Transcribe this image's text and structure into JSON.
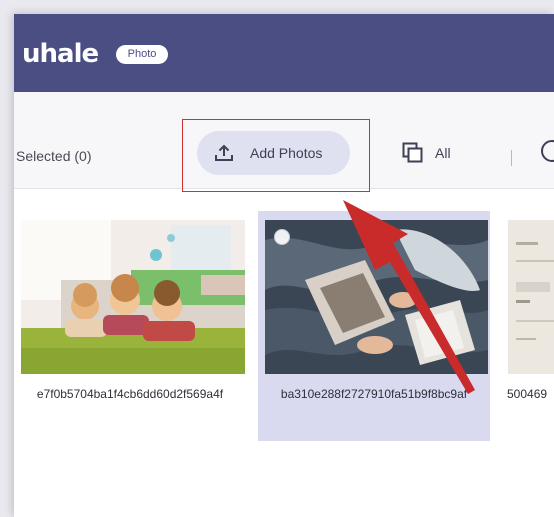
{
  "app": {
    "logo_text": "uhale",
    "logo_badge": "Photo"
  },
  "toolbar": {
    "selected_label": "Selected (0)",
    "add_photos_label": "Add Photos",
    "all_label": "All"
  },
  "photos": [
    {
      "filename": "e7f0b5704ba1f4cb6dd60d2f569a4f",
      "selected": false,
      "subject": "three children lying on green carpet"
    },
    {
      "filename": "ba310e288f2727910fa51b9f8bc9af",
      "selected": true,
      "subject": "person reading in bed on dark sheets"
    },
    {
      "filename": "500469",
      "selected": false,
      "subject": "printed document"
    }
  ],
  "colors": {
    "titlebar": "#4b4e83",
    "button_bg": "#dfe0f0",
    "selected_card": "#d9d9ef",
    "annotation_red": "#d2302f"
  },
  "icons": [
    "upload-icon",
    "copy-icon",
    "circle-icon",
    "red-arrow-annotation"
  ]
}
